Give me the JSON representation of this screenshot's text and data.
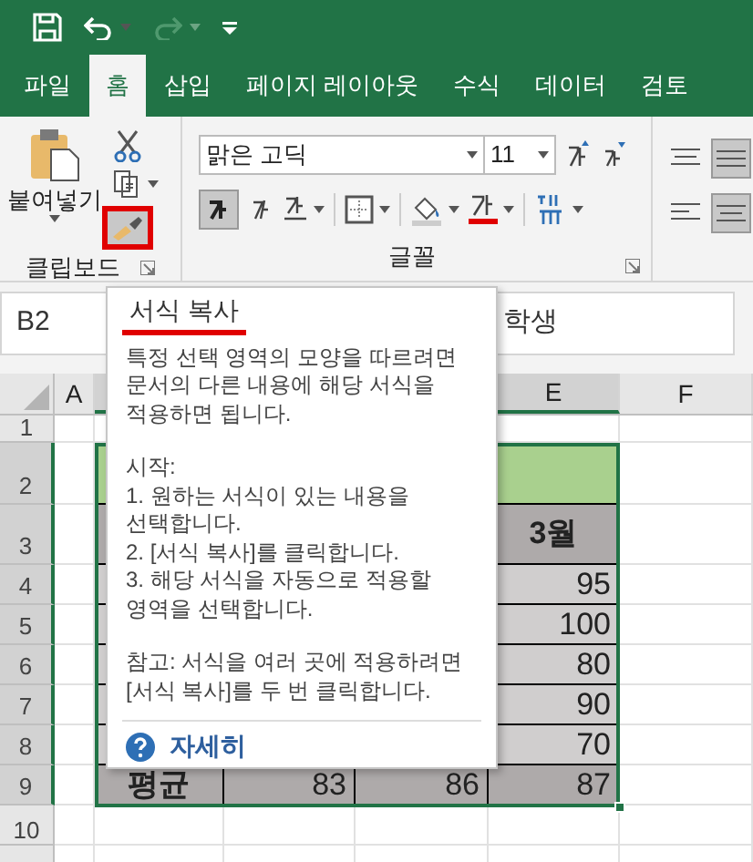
{
  "tabs": [
    {
      "label": "파일",
      "selected": false
    },
    {
      "label": "홈",
      "selected": true
    },
    {
      "label": "삽입",
      "selected": false
    },
    {
      "label": "페이지 레이아웃",
      "selected": false
    },
    {
      "label": "수식",
      "selected": false
    },
    {
      "label": "데이터",
      "selected": false
    },
    {
      "label": "검토",
      "selected": false
    }
  ],
  "clipboard": {
    "paste_label": "붙여넣기",
    "group_label": "클립보드",
    "format_painter_highlighted": true
  },
  "font": {
    "font_name": "맑은 고딕",
    "font_size": "11",
    "bold_on": true,
    "group_label": "글꼴"
  },
  "formula_bar": {
    "name_box": "B2",
    "formula": "학생"
  },
  "sheet": {
    "column_headers": {
      "a": "A",
      "e": "E",
      "f": "F"
    },
    "rows": [
      {
        "header": "1",
        "kind": "blank",
        "cells": {}
      },
      {
        "header": "2",
        "kind": "title",
        "cells": {}
      },
      {
        "header": "3",
        "kind": "header",
        "cells": {
          "e": "3월"
        }
      },
      {
        "header": "4",
        "kind": "body",
        "cells": {
          "e": "95"
        }
      },
      {
        "header": "5",
        "kind": "body",
        "cells": {
          "e": "100"
        }
      },
      {
        "header": "6",
        "kind": "body",
        "cells": {
          "e": "80"
        }
      },
      {
        "header": "7",
        "kind": "body",
        "cells": {
          "e": "90"
        }
      },
      {
        "header": "8",
        "kind": "body",
        "cells": {
          "e": "70"
        }
      },
      {
        "header": "9",
        "kind": "total",
        "cells": {
          "b": "평균",
          "c": "83",
          "d": "86",
          "e": "87"
        }
      },
      {
        "header": "10",
        "kind": "blank",
        "cells": {}
      },
      {
        "kind": "blank",
        "cells": {}
      }
    ]
  },
  "tooltip": {
    "title": "서식 복사",
    "intro": "특정 선택 영역의 모양을 따르려면\n문서의 다른 내용에 해당 서식을\n적용하면 됩니다.",
    "steps_heading": "시작:",
    "steps": [
      "1. 원하는 서식이 있는 내용을\n선택합니다.",
      "2. [서식 복사]를 클릭합니다.",
      "3. 해당 서식을 자동으로 적용할\n영역을 선택합니다."
    ],
    "note": "참고: 서식을 여러 곳에 적용하려면\n[서식 복사]를 두 번 클릭합니다.",
    "link": "자세히"
  }
}
